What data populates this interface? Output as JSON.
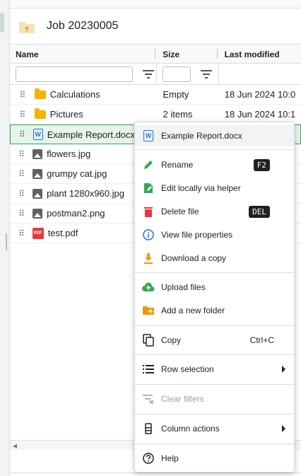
{
  "header": {
    "title": "Job 20230005"
  },
  "columns": {
    "name": "Name",
    "size": "Size",
    "modified": "Last modified"
  },
  "rows": [
    {
      "name": "Calculations",
      "size": "Empty",
      "modified": "18 Jun 2024 10:0",
      "icon": "folder-icon"
    },
    {
      "name": "Pictures",
      "size": "2 items",
      "modified": "18 Jun 2024 10:1",
      "icon": "folder-icon"
    },
    {
      "name": "Example Report.docx",
      "size": "",
      "modified": "24",
      "icon": "word-icon"
    },
    {
      "name": "flowers.jpg",
      "size": "",
      "modified": "55",
      "icon": "image-icon"
    },
    {
      "name": "grumpy cat.jpg",
      "size": "",
      "modified": "55",
      "icon": "image-icon"
    },
    {
      "name": "plant 1280x960.jpg",
      "size": "",
      "modified": "l:3",
      "icon": "image-icon"
    },
    {
      "name": "postman2.png",
      "size": "",
      "modified": "56",
      "icon": "image-icon"
    },
    {
      "name": "test.pdf",
      "size": "",
      "modified": "0:3",
      "icon": "pdf-icon"
    }
  ],
  "menu": {
    "header": "Example Report.docx",
    "rename": "Rename",
    "rename_key": "F2",
    "edit_locally": "Edit locally via helper",
    "delete": "Delete file",
    "delete_key": "DEL",
    "properties": "View file properties",
    "download": "Download a copy",
    "upload": "Upload files",
    "add_folder": "Add a new folder",
    "copy": "Copy",
    "copy_key": "Ctrl+C",
    "row_selection": "Row selection",
    "clear_filters": "Clear filters",
    "column_actions": "Column actions",
    "help": "Help",
    "word_badge": "W",
    "pdf_badge": "PDF"
  },
  "colors": {
    "accent": "#1a73e8",
    "selected_row": "#e6f4ea",
    "selected_border": "#34a853",
    "folder": "#f5b400"
  }
}
